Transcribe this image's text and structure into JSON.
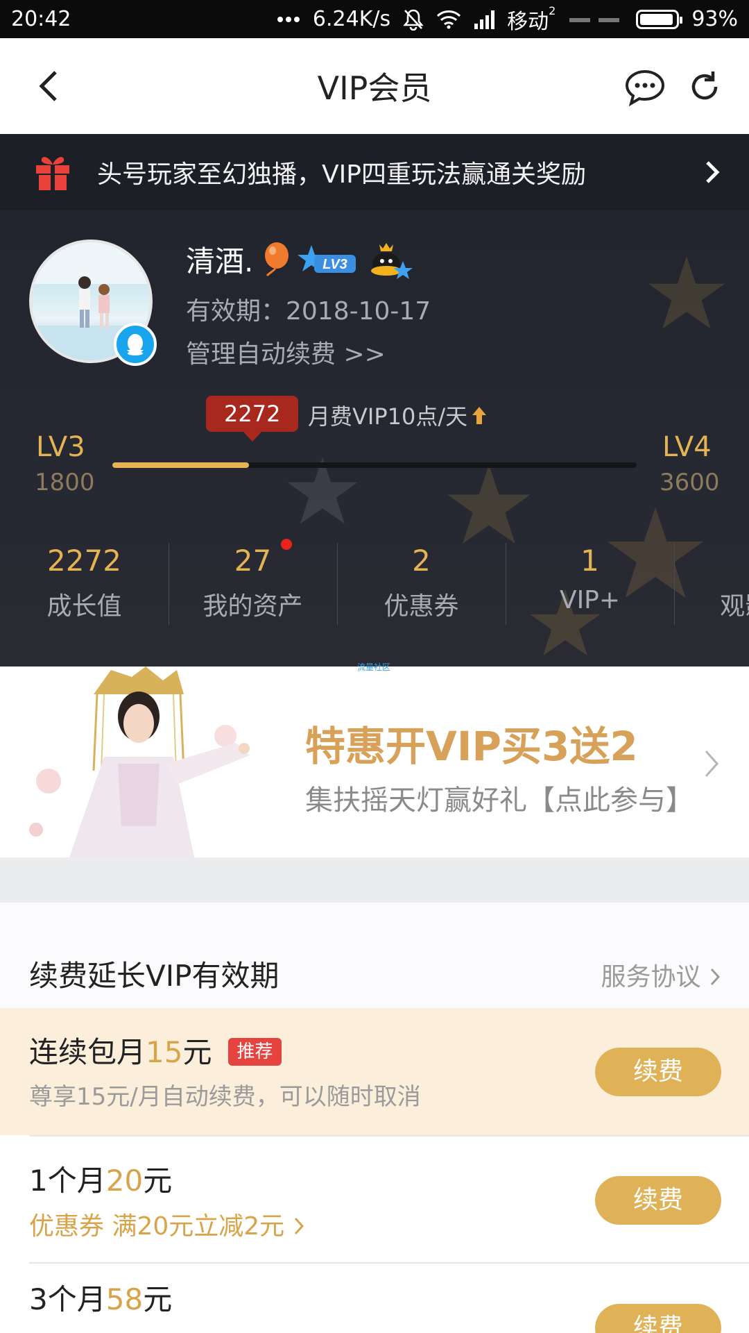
{
  "status_bar": {
    "time": "20:42",
    "speed": "6.24K/s",
    "carrier": "移动",
    "carrier_sub": "2",
    "battery": "93%",
    "battery_level": 0.93
  },
  "nav": {
    "title": "VIP会员"
  },
  "notice": {
    "text": "头号玩家至幻独播，VIP四重玩法赢通关奖励"
  },
  "profile": {
    "username": "清酒.",
    "level_badge": "LV3",
    "validity": "有效期：2018-10-17",
    "manage_link": "管理自动续费 >>",
    "points_bubble": "2272",
    "points_rate": "月费VIP10点/天",
    "level_left": "LV3",
    "level_left_points": "1800",
    "level_right": "LV4",
    "level_right_points": "3600",
    "progress": 0.26
  },
  "stats": [
    {
      "value": "2272",
      "label": "成长值"
    },
    {
      "value": "27",
      "label": "我的资产"
    },
    {
      "value": "2",
      "label": "优惠券"
    },
    {
      "value": "1",
      "label": "VIP+"
    },
    {
      "value": "",
      "label": "观影"
    }
  ],
  "banner": {
    "title": "特惠开VIP买3送2",
    "subtitle": "集扶摇天灯赢好礼【点此参与】"
  },
  "watermark": "流量社区",
  "renewal": {
    "heading": "续费延长VIP有效期",
    "agreement": "服务协议",
    "plans": [
      {
        "name_prefix": "连续包月",
        "amount": "15",
        "unit": "元",
        "tag": "推荐",
        "desc": "尊享15元/月自动续费，可以随时取消",
        "button": "续费"
      },
      {
        "name_prefix": "1个月",
        "amount": "20",
        "unit": "元",
        "coupon": "优惠券 满20元立减2元",
        "button": "续费"
      },
      {
        "name_prefix": "3个月",
        "amount": "58",
        "unit": "元",
        "button": "续费"
      }
    ]
  },
  "colors": {
    "gold": "#e4b354",
    "dark_bg": "#22252e",
    "red_bubble": "#a8281d",
    "button": "#e0b257",
    "tag": "#e4433f"
  }
}
